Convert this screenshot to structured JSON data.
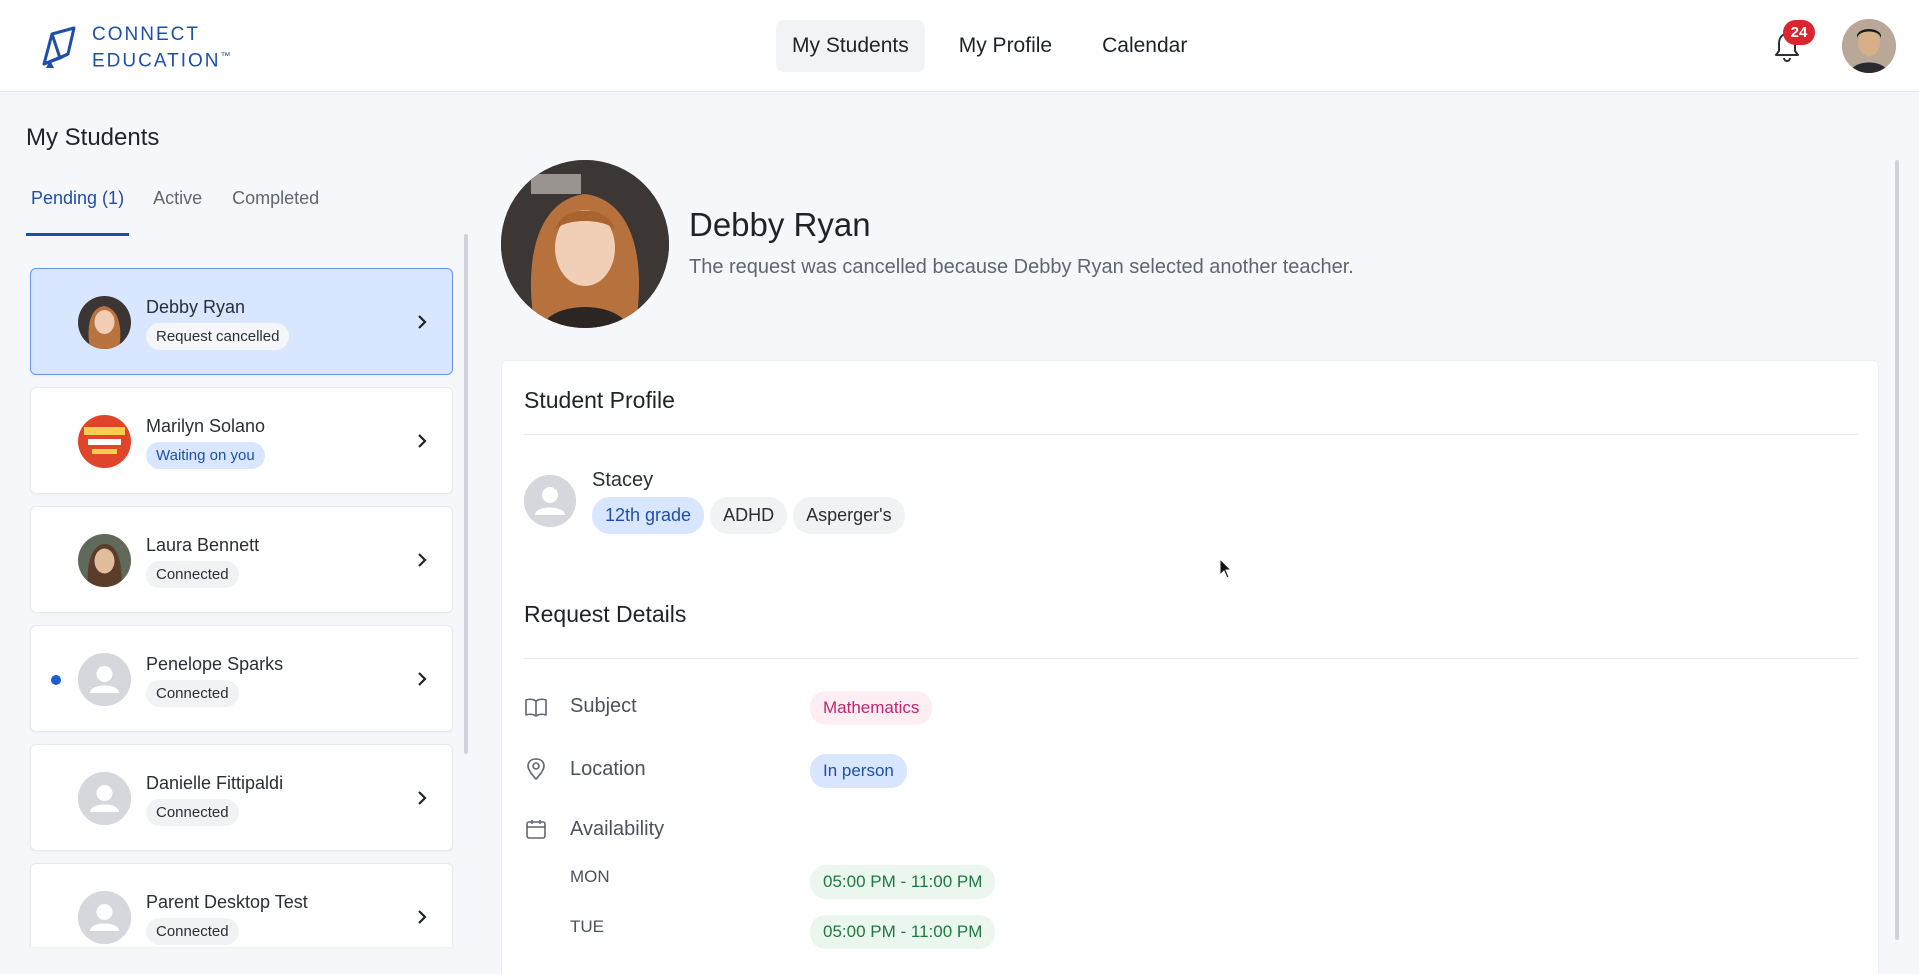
{
  "logo": {
    "line1": "CONNECT",
    "line2": "EDUCATION",
    "tm": "™"
  },
  "nav": {
    "items": [
      {
        "label": "My Students",
        "active": true
      },
      {
        "label": "My Profile",
        "active": false
      },
      {
        "label": "Calendar",
        "active": false
      }
    ]
  },
  "notifications": {
    "count": "24"
  },
  "left": {
    "title": "My Students",
    "tabs": [
      {
        "label": "Pending (1)",
        "active": true
      },
      {
        "label": "Active",
        "active": false
      },
      {
        "label": "Completed",
        "active": false
      }
    ],
    "students": [
      {
        "name": "Debby Ryan",
        "status": "Request cancelled"
      },
      {
        "name": "Marilyn Solano",
        "status": "Waiting on you"
      },
      {
        "name": "Laura Bennett",
        "status": "Connected"
      },
      {
        "name": "Penelope Sparks",
        "status": "Connected"
      },
      {
        "name": "Danielle Fittipaldi",
        "status": "Connected"
      },
      {
        "name": "Parent Desktop Test",
        "status": "Connected"
      }
    ]
  },
  "detail": {
    "name": "Debby Ryan",
    "message": "The request was cancelled because Debby Ryan selected another teacher.",
    "profile": {
      "title": "Student Profile",
      "student_name": "Stacey",
      "tags": [
        "12th grade",
        "ADHD",
        "Asperger's"
      ]
    },
    "request": {
      "title": "Request Details",
      "subject_label": "Subject",
      "subject_value": "Mathematics",
      "location_label": "Location",
      "location_value": "In person",
      "availability_label": "Availability",
      "availability": [
        {
          "day": "MON",
          "time": "05:00 PM - 11:00 PM"
        },
        {
          "day": "TUE",
          "time": "05:00 PM - 11:00 PM"
        }
      ]
    }
  },
  "colors": {
    "accent": "#1e4fa8",
    "badge": "#d9262f",
    "selected_bg": "#d8e6ff"
  }
}
